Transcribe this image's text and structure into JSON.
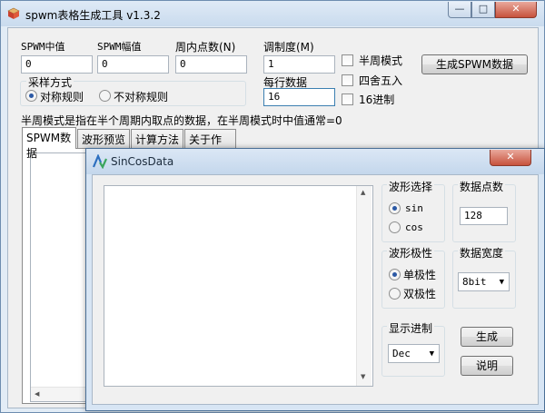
{
  "app": {
    "title": "spwm表格生成工具 v1.3.2",
    "title_buttons": {
      "minimize": "—",
      "maximize": "□",
      "close": "✕"
    }
  },
  "params": {
    "center": {
      "label": "SPWM中值",
      "value": "0"
    },
    "amplitude": {
      "label": "SPWM幅值",
      "value": "0"
    },
    "points": {
      "label": "周内点数(N)",
      "value": "0"
    },
    "modulation": {
      "label": "调制度(M)",
      "value": "1"
    },
    "per_row": {
      "label": "每行数据",
      "value": "16"
    }
  },
  "sampling": {
    "title": "采样方式",
    "symmetric": "对称规则",
    "asymmetric": "不对称规则",
    "selected": "对称规则"
  },
  "options": {
    "half_cycle": "半周模式",
    "round": "四舍五入",
    "hex": "16进制"
  },
  "generate_button": "生成SPWM数据",
  "hint": "半周模式是指在半个周期内取点的数据，在半周模式时中值通常=0",
  "tabs": [
    "SPWM数据",
    "波形预览",
    "计算方法",
    "关于作者"
  ],
  "dialog": {
    "title": "SinCosData",
    "close": "✕",
    "wave_select": {
      "title": "波形选择",
      "sin": "sin",
      "cos": "cos",
      "selected": "sin"
    },
    "data_points": {
      "title": "数据点数",
      "value": "128"
    },
    "polarity": {
      "title": "波形极性",
      "unipolar": "单极性",
      "bipolar": "双极性",
      "selected": "单极性"
    },
    "data_width": {
      "title": "数据宽度",
      "value": "8bit"
    },
    "radix": {
      "title": "显示进制",
      "value": "Dec"
    },
    "generate_button": "生成",
    "help_button": "说明",
    "output_text": ""
  }
}
